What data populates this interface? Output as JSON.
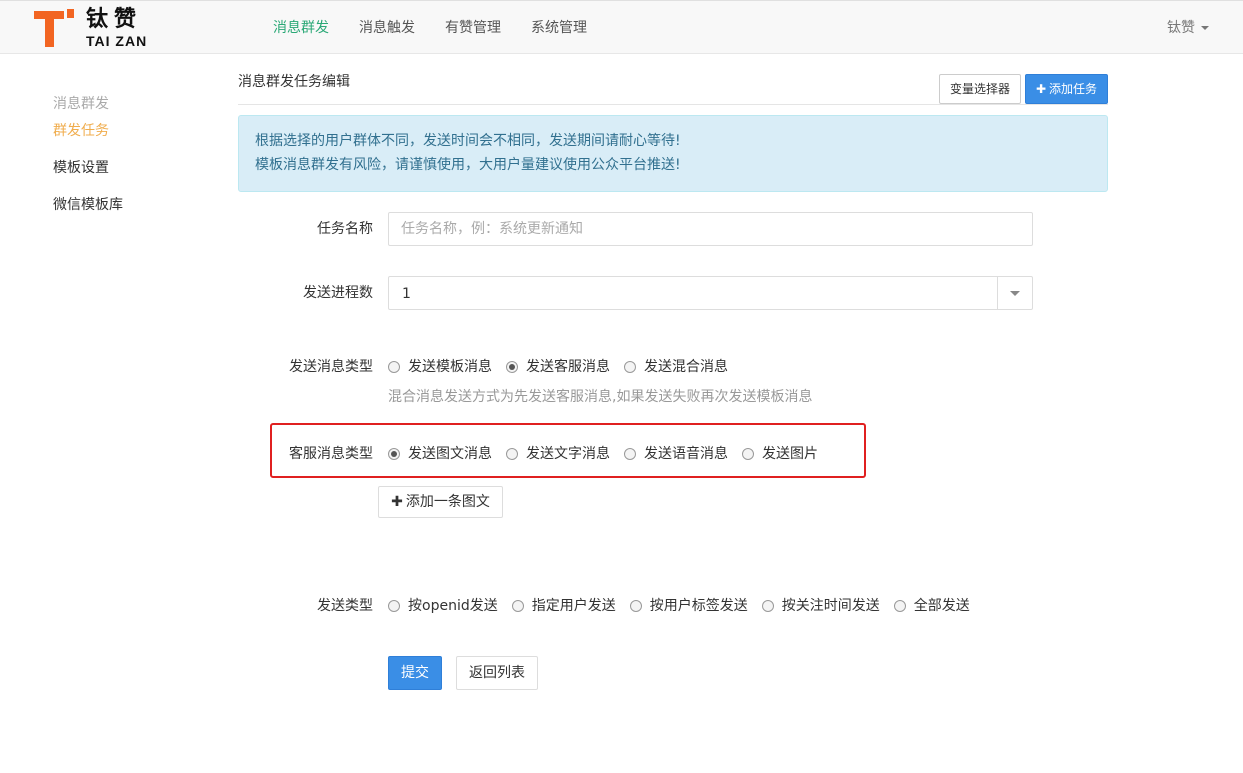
{
  "brand": {
    "name_cn": "钛赞",
    "name_en": "TAI ZAN",
    "accent": "#f26522"
  },
  "nav": {
    "items": [
      {
        "label": "消息群发",
        "active": true
      },
      {
        "label": "消息触发",
        "active": false
      },
      {
        "label": "有赞管理",
        "active": false
      },
      {
        "label": "系统管理",
        "active": false
      }
    ],
    "user": "钛赞"
  },
  "sidebar": {
    "heading": "消息群发",
    "items": [
      {
        "label": "群发任务",
        "active": true
      },
      {
        "label": "模板设置",
        "active": false
      },
      {
        "label": "微信模板库",
        "active": false
      }
    ]
  },
  "page": {
    "title": "消息群发任务编辑",
    "var_selector_label": "变量选择器",
    "add_task_label": "添加任务"
  },
  "alert": {
    "line1": "根据选择的用户群体不同，发送时间会不相同，发送期间请耐心等待!",
    "line2": "模板消息群发有风险，请谨慎使用，大用户量建议使用公众平台推送!"
  },
  "form": {
    "task_name": {
      "label": "任务名称",
      "placeholder": "任务名称，例：系统更新通知",
      "value": ""
    },
    "process_count": {
      "label": "发送进程数",
      "value": "1"
    },
    "msg_type": {
      "label": "发送消息类型",
      "options": [
        {
          "label": "发送模板消息",
          "checked": false
        },
        {
          "label": "发送客服消息",
          "checked": true
        },
        {
          "label": "发送混合消息",
          "checked": false
        }
      ],
      "help": "混合消息发送方式为先发送客服消息,如果发送失败再次发送模板消息"
    },
    "cs_type": {
      "label": "客服消息类型",
      "options": [
        {
          "label": "发送图文消息",
          "checked": true
        },
        {
          "label": "发送文字消息",
          "checked": false
        },
        {
          "label": "发送语音消息",
          "checked": false
        },
        {
          "label": "发送图片",
          "checked": false
        }
      ]
    },
    "add_article_label": "添加一条图文",
    "send_type": {
      "label": "发送类型",
      "options": [
        {
          "label": "按openid发送",
          "checked": false
        },
        {
          "label": "指定用户发送",
          "checked": false
        },
        {
          "label": "按用户标签发送",
          "checked": false
        },
        {
          "label": "按关注时间发送",
          "checked": false
        },
        {
          "label": "全部发送",
          "checked": false
        }
      ]
    },
    "submit_label": "提交",
    "back_label": "返回列表"
  }
}
